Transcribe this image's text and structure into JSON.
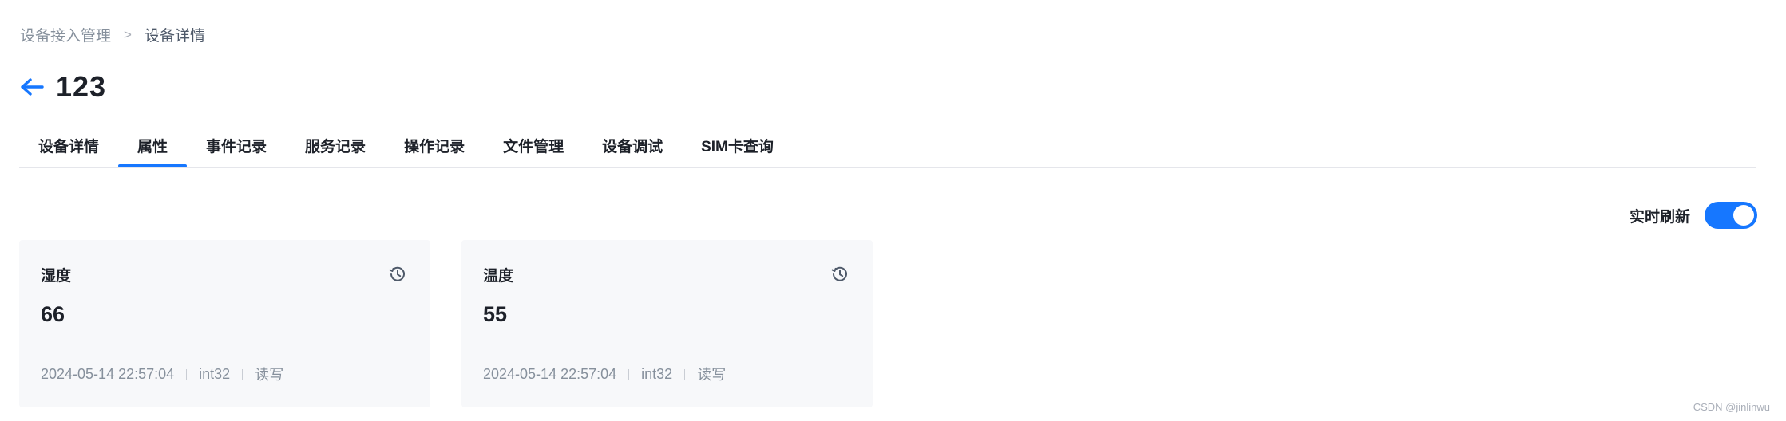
{
  "breadcrumb": {
    "parent": "设备接入管理",
    "separator": ">",
    "current": "设备详情"
  },
  "header": {
    "back_icon": "arrow-left-icon",
    "title": "123"
  },
  "tabs": [
    {
      "label": "设备详情",
      "active": false
    },
    {
      "label": "属性",
      "active": true
    },
    {
      "label": "事件记录",
      "active": false
    },
    {
      "label": "服务记录",
      "active": false
    },
    {
      "label": "操作记录",
      "active": false
    },
    {
      "label": "文件管理",
      "active": false
    },
    {
      "label": "设备调试",
      "active": false
    },
    {
      "label": "SIM卡查询",
      "active": false
    }
  ],
  "realtime": {
    "label": "实时刷新",
    "enabled": true
  },
  "properties": [
    {
      "name": "湿度",
      "value": "66",
      "timestamp": "2024-05-14 22:57:04",
      "data_type": "int32",
      "access": "读写",
      "icon": "history-icon"
    },
    {
      "name": "温度",
      "value": "55",
      "timestamp": "2024-05-14 22:57:04",
      "data_type": "int32",
      "access": "读写",
      "icon": "history-icon"
    }
  ],
  "watermark": "CSDN @jinlinwu",
  "colors": {
    "accent": "#1677ff",
    "card_bg": "#f7f8fa",
    "muted_text": "#86909c"
  }
}
